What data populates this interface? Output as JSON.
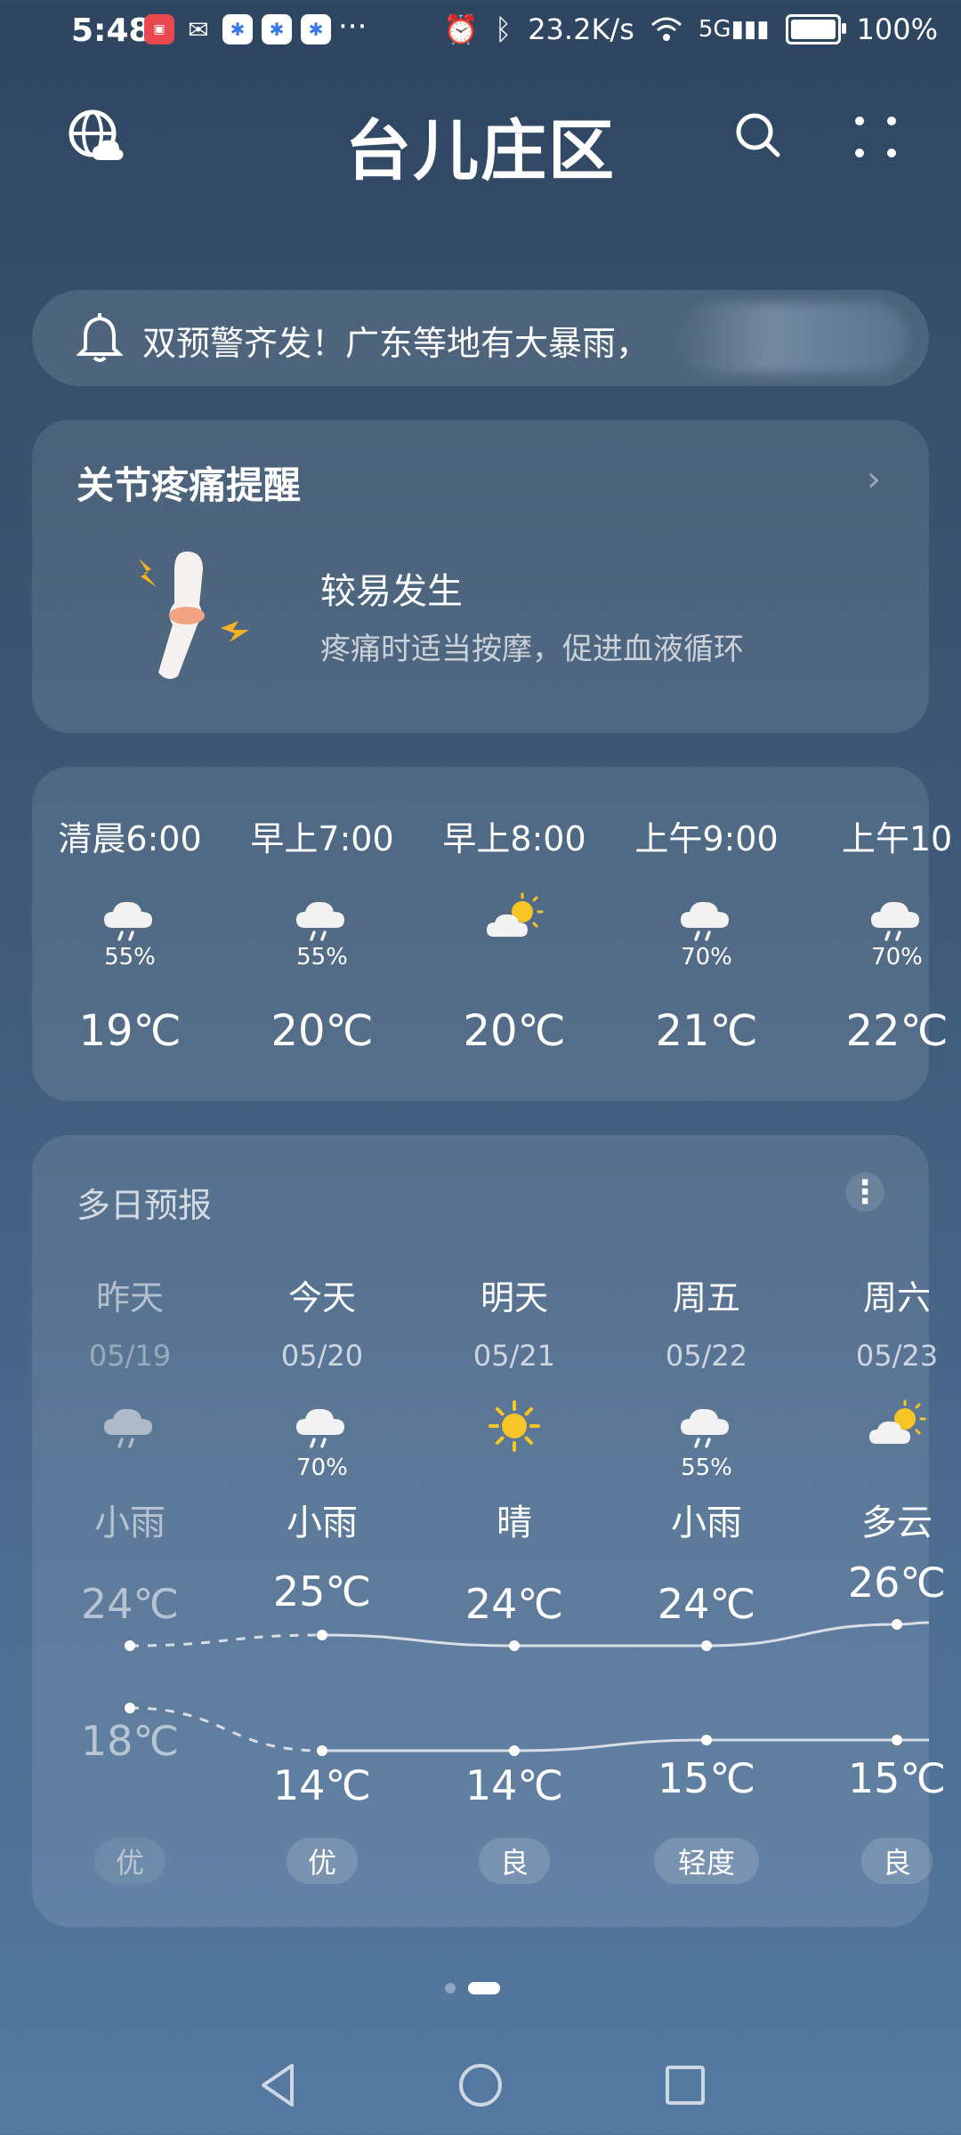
{
  "status_bar": {
    "time": "5:48",
    "app_badge": "HUAWEI",
    "overflow": "···",
    "network_speed": "23.2K/s",
    "signal_label": "5G",
    "battery": "100%"
  },
  "header": {
    "city": "台儿庄区"
  },
  "alert": {
    "text": "双预警齐发！广东等地有大暴雨，"
  },
  "pain_reminder": {
    "title": "关节疼痛提醒",
    "level": "较易发生",
    "tip": "疼痛时适当按摩，促进血液循环"
  },
  "hourly": [
    {
      "time": "清晨6:00",
      "icon": "rain-cloud-icon",
      "precip": "55%",
      "temp": "19℃"
    },
    {
      "time": "早上7:00",
      "icon": "rain-cloud-icon",
      "precip": "55%",
      "temp": "20℃"
    },
    {
      "time": "早上8:00",
      "icon": "partly-sunny-icon",
      "precip": "",
      "temp": "20℃"
    },
    {
      "time": "上午9:00",
      "icon": "rain-cloud-icon",
      "precip": "70%",
      "temp": "21℃"
    },
    {
      "time": "上午10",
      "icon": "rain-cloud-icon",
      "precip": "70%",
      "temp": "22℃"
    }
  ],
  "daily": {
    "title": "多日预报",
    "more": "⋮",
    "days": [
      {
        "name": "昨天",
        "date": "05/19",
        "icon": "rain-cloud-icon",
        "precip": "",
        "cond": "小雨",
        "high": "24℃",
        "low": "18℃",
        "aqi": "优"
      },
      {
        "name": "今天",
        "date": "05/20",
        "icon": "rain-cloud-icon",
        "precip": "70%",
        "cond": "小雨",
        "high": "25℃",
        "low": "14℃",
        "aqi": "优"
      },
      {
        "name": "明天",
        "date": "05/21",
        "icon": "sun-icon",
        "precip": "",
        "cond": "晴",
        "high": "24℃",
        "low": "14℃",
        "aqi": "良"
      },
      {
        "name": "周五",
        "date": "05/22",
        "icon": "rain-cloud-icon",
        "precip": "55%",
        "cond": "小雨",
        "high": "24℃",
        "low": "15℃",
        "aqi": "轻度"
      },
      {
        "name": "周六",
        "date": "05/23",
        "icon": "partly-sunny-icon",
        "precip": "",
        "cond": "多云",
        "high": "26℃",
        "low": "15℃",
        "aqi": "良"
      }
    ]
  },
  "pager": {
    "count": 2,
    "active": 2
  }
}
